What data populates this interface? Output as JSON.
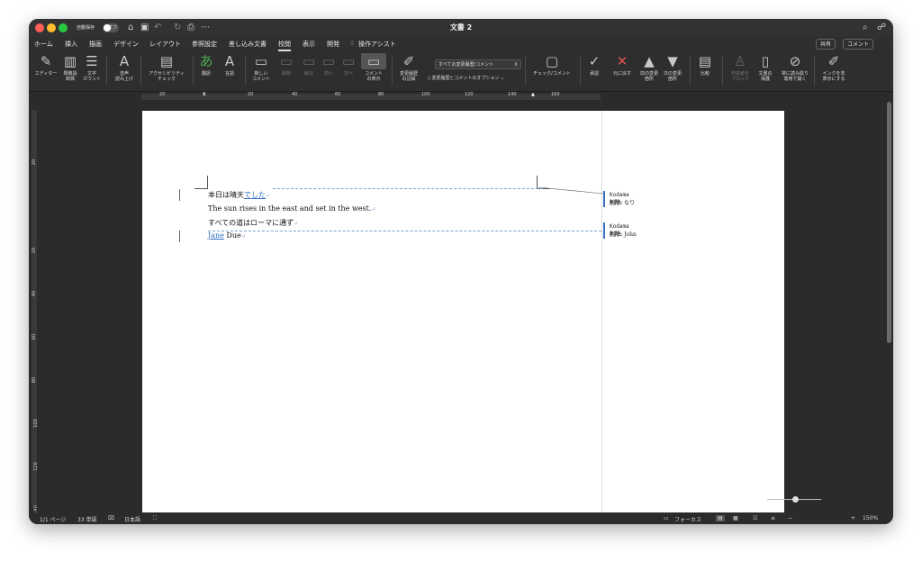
{
  "window": {
    "title": "文書 2",
    "autosave_label": "自動保存",
    "autosave_state": "オフ"
  },
  "tabs": [
    {
      "label": "ホーム"
    },
    {
      "label": "挿入"
    },
    {
      "label": "描画"
    },
    {
      "label": "デザイン"
    },
    {
      "label": "レイアウト"
    },
    {
      "label": "参照設定"
    },
    {
      "label": "差し込み文書"
    },
    {
      "label": "校閲",
      "active": true
    },
    {
      "label": "表示"
    },
    {
      "label": "開発"
    },
    {
      "label": "操作アシスト"
    }
  ],
  "tab_actions": {
    "share": "共有",
    "comment": "コメント"
  },
  "ribbon": {
    "editor": "エディター",
    "thesaurus": "類義語\n辞典",
    "word_count": "文字\nカウント",
    "read_aloud": "音声\n読み上げ",
    "accessibility": "アクセシビリティ\nチェック",
    "translate": "翻訳",
    "language": "言語",
    "new_comment": "新しい\nコメント",
    "delete": "削除",
    "resolve": "解決",
    "previous": "前へ",
    "next": "次へ",
    "show_comments": "コメント\nの表示",
    "track_changes": "変更履歴\nの記録",
    "markup_select": "すべての変更履歴/コメント",
    "markup_options": "変更履歴とコメントのオプション",
    "check_comment": "チェック/コメント",
    "accept": "承認",
    "reject": "元に戻す",
    "prev_change": "前の変更\n箇所",
    "next_change": "次の変更\n箇所",
    "compare": "比較",
    "block_authors": "作成者を\nブロック",
    "protect": "文書の\n保護",
    "always_read_only": "常に読み取り\n専用で開く",
    "hide_ink": "インクを非\n表示にする"
  },
  "ruler": {
    "h_marks": [
      "20",
      "20",
      "40",
      "60",
      "80",
      "100",
      "120",
      "140",
      "160"
    ],
    "v_marks": [
      "20",
      "20",
      "40",
      "60",
      "80",
      "100",
      "120",
      "140"
    ]
  },
  "document": {
    "lines": [
      {
        "parts": [
          {
            "text": "本日は晴天",
            "ins": false
          },
          {
            "text": "でした",
            "ins": true
          }
        ]
      },
      {
        "parts": [
          {
            "text": "The sun rises in the east and set in the west.",
            "ins": false
          }
        ]
      },
      {
        "parts": [
          {
            "text": "すべての道はローマに通ず",
            "ins": false
          }
        ]
      },
      {
        "parts": [
          {
            "text": "Jane",
            "ins": true
          },
          {
            "text": " Due",
            "ins": false
          }
        ]
      }
    ],
    "pilcrow": "↵"
  },
  "comments": [
    {
      "author": "Kodama",
      "label": "削除:",
      "text": "なり"
    },
    {
      "author": "Kodama",
      "label": "削除:",
      "text": "John"
    }
  ],
  "status": {
    "page": "1/1 ページ",
    "words": "33 単語",
    "language": "日本語",
    "focus": "フォーカス",
    "zoom": "150%"
  }
}
